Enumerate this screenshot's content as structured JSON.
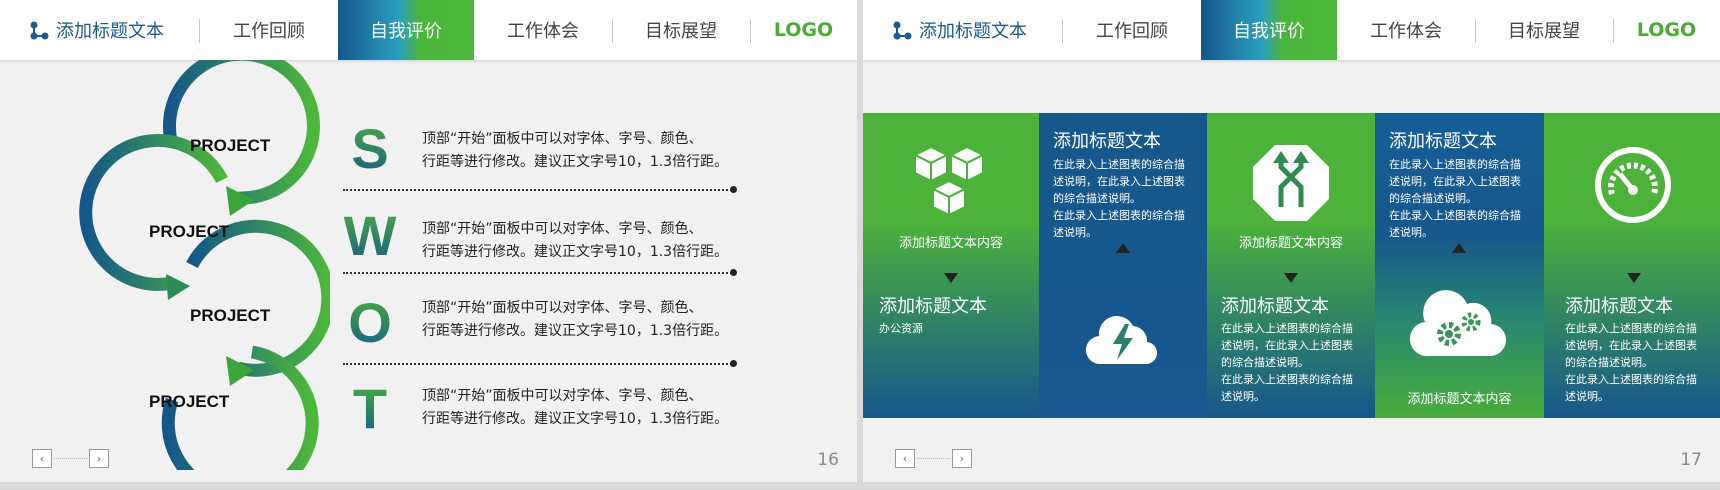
{
  "nav": {
    "brand": "添加标题文本",
    "items": [
      "工作回顾",
      "自我评价",
      "工作体会",
      "目标展望"
    ],
    "logo": "LOGO"
  },
  "slide1": {
    "page": "16",
    "projects": [
      "PROJECT",
      "PROJECT",
      "PROJECT",
      "PROJECT"
    ],
    "swot": [
      {
        "letter": "S",
        "line1": "顶部“开始”面板中可以对字体、字号、颜色、",
        "line2": "行距等进行修改。建议正文字号10，1.3倍行距。"
      },
      {
        "letter": "W",
        "line1": "顶部“开始”面板中可以对字体、字号、颜色、",
        "line2": "行距等进行修改。建议正文字号10，1.3倍行距。"
      },
      {
        "letter": "O",
        "line1": "顶部“开始”面板中可以对字体、字号、颜色、",
        "line2": "行距等进行修改。建议正文字号10，1.3倍行距。"
      },
      {
        "letter": "T",
        "line1": "顶部“开始”面板中可以对字体、字号、颜色、",
        "line2": "行距等进行修改。建议正文字号10，1.3倍行距。"
      }
    ]
  },
  "slide2": {
    "page": "17",
    "cube_caption": "添加标题文本内容",
    "block1_title": "添加标题文本",
    "block1_sub": "办公资源",
    "block2_title": "添加标题文本",
    "block2_text": [
      "在此录入上述图表的综合描",
      "述说明，在此录入上述图表",
      "的综合描述说明。",
      "在此录入上述图表的综合描",
      "述说明。"
    ],
    "arrows_caption": "添加标题文本内容",
    "block3_title": "添加标题文本",
    "block3_text": [
      "在此录入上述图表的综合描",
      "述说明，在此录入上述图表",
      "的综合描述说明。",
      "在此录入上述图表的综合描",
      "述说明。"
    ],
    "block4_title": "添加标题文本",
    "block4_text": [
      "在此录入上述图表的综合描",
      "述说明，在此录入上述图表",
      "的综合描述说明。",
      "在此录入上述图表的综合描",
      "述说明。"
    ],
    "gears_caption": "添加标题文本内容",
    "block5_title": "添加标题文本",
    "block5_text": [
      "在此录入上述图表的综合描",
      "述说明，在此录入上述图表",
      "的综合描述说明。",
      "在此录入上述图表的综合描",
      "述说明。"
    ]
  }
}
